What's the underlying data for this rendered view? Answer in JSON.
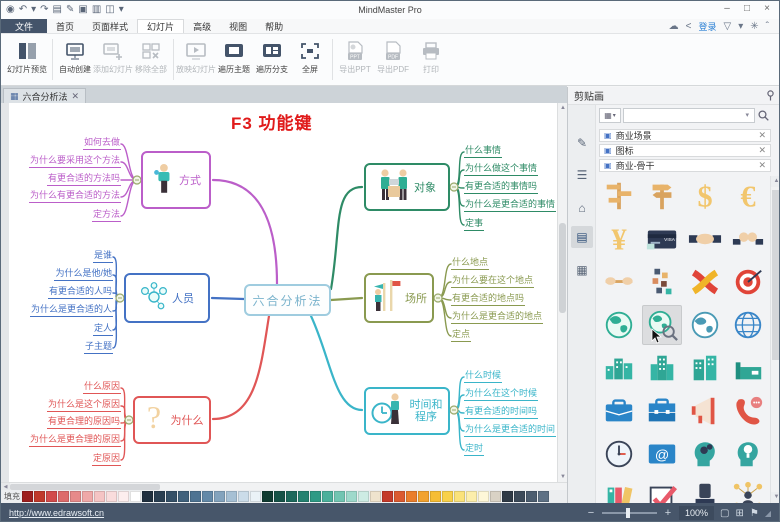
{
  "window": {
    "title": "MindMaster Pro",
    "controls": [
      {
        "name": "minimize-button",
        "glyph": "–"
      },
      {
        "name": "maximize-button",
        "glyph": "□"
      },
      {
        "name": "close-button",
        "glyph": "×"
      }
    ]
  },
  "quick_access": {
    "icons": [
      {
        "name": "app-logo",
        "glyph": "◉"
      },
      {
        "name": "undo-icon",
        "glyph": "↶"
      },
      {
        "name": "undo-menu-icon",
        "glyph": "▾"
      },
      {
        "name": "redo-icon",
        "glyph": "↷"
      },
      {
        "name": "import-icon",
        "glyph": "▤"
      },
      {
        "name": "theme-icon",
        "glyph": "✎"
      },
      {
        "name": "save-icon",
        "glyph": "▣"
      },
      {
        "name": "print-quick-icon",
        "glyph": "▥"
      },
      {
        "name": "export-icon",
        "glyph": "◫"
      },
      {
        "name": "more-icon",
        "glyph": "▾"
      }
    ]
  },
  "menu": {
    "file_label": "文件",
    "tabs": [
      "首页",
      "页面样式",
      "幻灯片",
      "高级",
      "视图",
      "帮助"
    ],
    "active_tab": "幻灯片",
    "right": {
      "login_label": "登录",
      "icons": [
        {
          "name": "cloud-icon",
          "glyph": "☁"
        },
        {
          "name": "share-icon",
          "glyph": "<"
        },
        {
          "name": "skin-icon",
          "glyph": "▽"
        },
        {
          "name": "skin-menu-icon",
          "glyph": "▾"
        },
        {
          "name": "community-icon",
          "glyph": "✳"
        },
        {
          "name": "collapse-ribbon-icon",
          "glyph": "ˆ"
        }
      ]
    }
  },
  "ribbon": {
    "groups": [
      {
        "buttons": [
          {
            "label": "幻灯片预览",
            "icon": "slides",
            "enabled": true,
            "big": true
          }
        ]
      },
      {
        "buttons": [
          {
            "label": "自动创建",
            "icon": "board",
            "enabled": true
          },
          {
            "label": "添加幻灯片",
            "icon": "board-add",
            "enabled": false
          },
          {
            "label": "移除全部",
            "icon": "slides-del",
            "enabled": false
          }
        ]
      },
      {
        "buttons": [
          {
            "label": "放映幻灯片",
            "icon": "play",
            "enabled": false
          },
          {
            "label": "遍历主题",
            "icon": "frame",
            "enabled": true
          },
          {
            "label": "遍历分支",
            "icon": "frame-branch",
            "enabled": true
          },
          {
            "label": "全屏",
            "icon": "fullscreen",
            "enabled": true
          }
        ]
      },
      {
        "buttons": [
          {
            "label": "导出PPT",
            "icon": "ppt",
            "enabled": false
          },
          {
            "label": "导出PDF",
            "icon": "pdf",
            "enabled": false
          },
          {
            "label": "打印",
            "icon": "print",
            "enabled": false
          }
        ]
      }
    ]
  },
  "document_tab": {
    "label": "六合分析法"
  },
  "canvas": {
    "annotation": "F3 功能键"
  },
  "mindmap": {
    "center": {
      "label": "六合分析法"
    },
    "branches": [
      {
        "label": "方式",
        "color": "#bb5ec9",
        "icon": "person",
        "side": "left",
        "subtopics": [
          "如何去做",
          "为什么要采用这个方法",
          "有更合适的方法吗",
          "为什么有更合适的方法",
          "定方法"
        ]
      },
      {
        "label": "人员",
        "color": "#4472c4",
        "icon": "network",
        "side": "left",
        "subtopics": [
          "是谁",
          "为什么是他/她",
          "有更合适的人吗",
          "为什么是更合适的人",
          "定人",
          "子主题"
        ]
      },
      {
        "label": "为什么",
        "color": "#e05656",
        "icon": "question",
        "side": "left",
        "subtopics": [
          "什么原因",
          "为什么是这个原因",
          "有更合理的原因吗",
          "为什么是更合理的原因",
          "定原因"
        ]
      },
      {
        "label": "对象",
        "color": "#2e8b66",
        "icon": "people",
        "side": "right",
        "subtopics": [
          "什么事情",
          "为什么做这个事情",
          "有更合适的事情吗",
          "为什么是更合适的事情",
          "定事"
        ]
      },
      {
        "label": "场所",
        "color": "#8a9a50",
        "icon": "flags",
        "side": "right",
        "subtopics": [
          "什么地点",
          "为什么要在这个地点",
          "有更合适的地点吗",
          "为什么是更合适的地点",
          "定点"
        ]
      },
      {
        "label": "时间和程序",
        "color": "#3ab5c9",
        "icon": "clockperson",
        "side": "right",
        "subtopics": [
          "什么时候",
          "为什么在这个时候",
          "有更合适的时间吗",
          "为什么是更合适的时间",
          "定时"
        ]
      }
    ]
  },
  "clipart_panel": {
    "title": "剪贴画",
    "categories": [
      "商业场景",
      "图标",
      "商业-骨干"
    ],
    "selected_icon_index": 13,
    "icons": [
      "signpost",
      "signpost-arrows",
      "dollar",
      "euro",
      "yen",
      "credit-card",
      "handshake",
      "cheers",
      "tug-of-war",
      "team-blocks",
      "knot",
      "target",
      "globe-green",
      "globe-search",
      "globe-map",
      "globe-grid",
      "city",
      "skyscraper",
      "office-buildings",
      "factory",
      "briefcase",
      "briefcase-open",
      "megaphone",
      "phone-chat",
      "clock",
      "email",
      "head-gears",
      "head-idea",
      "books",
      "checkmark",
      "chair",
      "org-chart"
    ],
    "side_icons": [
      {
        "name": "style-brush-icon",
        "glyph": "✎"
      },
      {
        "name": "outline-icon",
        "glyph": "☰"
      },
      {
        "name": "marker-icon",
        "glyph": "⌂"
      },
      {
        "name": "clipart-icon",
        "glyph": "▤"
      },
      {
        "name": "task-icon",
        "glyph": "▦"
      }
    ]
  },
  "palette": {
    "fill_label": "填充",
    "swatches": [
      "#9e1f1f",
      "#c0392b",
      "#d24b4b",
      "#dd6b6b",
      "#e78a8a",
      "#efa8a8",
      "#f5c4c4",
      "#f9dcdc",
      "#fdeeee",
      "#ffffff",
      "#20303f",
      "#2a3f52",
      "#355067",
      "#40617c",
      "#4e7392",
      "#6389a8",
      "#83a3bd",
      "#a6c0d4",
      "#cbdce9",
      "#eaf2f7",
      "#0f3b31",
      "#155247",
      "#1c695c",
      "#248170",
      "#2e9a85",
      "#4bb09b",
      "#72c5b2",
      "#9ed9cb",
      "#cdece4",
      "#efe3cd",
      "#c43a2a",
      "#db5a30",
      "#ea7e2c",
      "#f2a22e",
      "#f6bd34",
      "#f8d14a",
      "#fae27a",
      "#fceeab",
      "#fef7d8",
      "#d9d2c5",
      "#2f3a46",
      "#3c4a59",
      "#4c5d6f",
      "#5e7185"
    ]
  },
  "status_bar": {
    "link": "http://www.edrawsoft.cn",
    "zoom_value": "100%",
    "icons": [
      {
        "name": "fit-window-icon",
        "glyph": "▢"
      },
      {
        "name": "pan-mode-icon",
        "glyph": "⊞"
      },
      {
        "name": "find-icon",
        "glyph": "⚑"
      }
    ]
  }
}
